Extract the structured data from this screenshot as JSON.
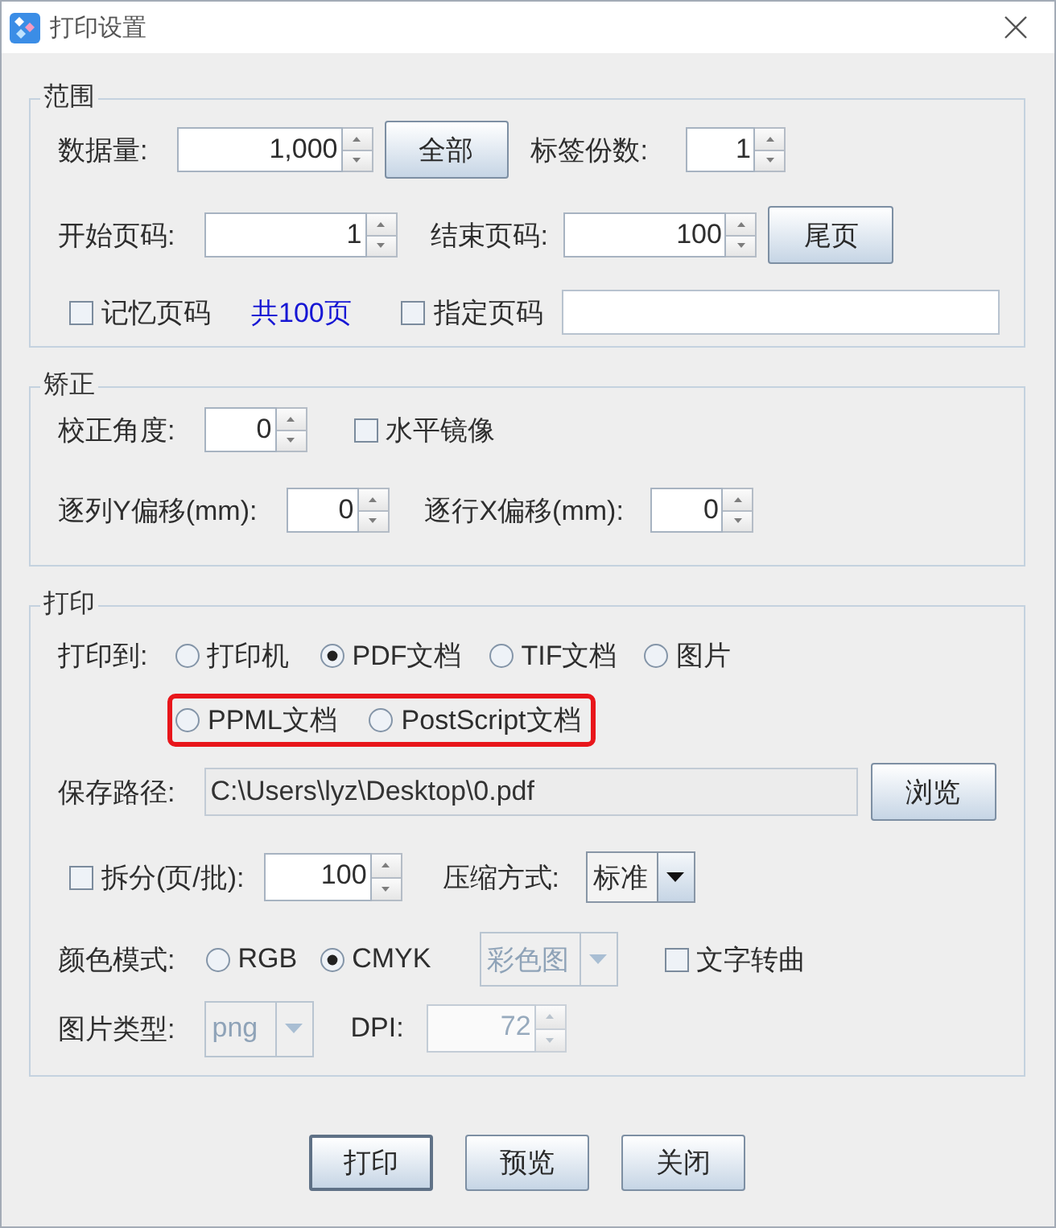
{
  "window": {
    "title": "打印设置"
  },
  "groups": [
    {
      "legend": "范围",
      "rows": [
        [
          {
            "kind": "label",
            "text": "数据量:"
          },
          {
            "kind": "spinner",
            "value": "1,000",
            "disabled": false
          },
          {
            "kind": "button",
            "label": "全部"
          },
          {
            "kind": "label",
            "text": "标签份数:"
          },
          {
            "kind": "spinner",
            "value": "1",
            "disabled": false
          }
        ],
        [
          {
            "kind": "label",
            "text": "开始页码:"
          },
          {
            "kind": "spinner",
            "value": "1",
            "disabled": false
          },
          {
            "kind": "label",
            "text": "结束页码:"
          },
          {
            "kind": "spinner",
            "value": "100",
            "disabled": false
          },
          {
            "kind": "button",
            "label": "尾页"
          }
        ],
        [
          {
            "kind": "checkbox",
            "label": "记忆页码",
            "checked": false
          },
          {
            "kind": "note",
            "text": "共100页"
          },
          {
            "kind": "checkbox",
            "label": "指定页码",
            "checked": false
          },
          {
            "kind": "field",
            "readonly": false
          }
        ]
      ]
    },
    {
      "legend": "矫正",
      "rows": [
        [
          {
            "kind": "label",
            "text": "校正角度:"
          },
          {
            "kind": "spinner",
            "value": "0",
            "disabled": false
          },
          {
            "kind": "checkbox",
            "label": "水平镜像",
            "checked": false
          }
        ],
        [
          {
            "kind": "label",
            "text": "逐列Y偏移(mm):"
          },
          {
            "kind": "spinner",
            "value": "0",
            "disabled": false
          },
          {
            "kind": "label",
            "text": "逐行X偏移(mm):"
          },
          {
            "kind": "spinner",
            "value": "0",
            "disabled": false
          }
        ]
      ]
    },
    {
      "legend": "打印",
      "rows": [
        [
          {
            "kind": "label",
            "text": "打印到:"
          },
          {
            "kind": "radio",
            "label": "打印机",
            "selected": false
          },
          {
            "kind": "radio",
            "label": "PDF文档",
            "selected": true
          },
          {
            "kind": "radio",
            "label": "TIF文档",
            "selected": false
          },
          {
            "kind": "radio",
            "label": "图片",
            "selected": false
          }
        ],
        [
          {
            "kind": "highlight",
            "items": [
              {
                "kind": "radio",
                "label": "PPML文档",
                "selected": false
              },
              {
                "kind": "radio",
                "label": "PostScript文档",
                "selected": false
              }
            ]
          }
        ],
        [
          {
            "kind": "label",
            "text": "保存路径:"
          },
          {
            "kind": "field",
            "value": "C:\\Users\\lyz\\Desktop\\0.pdf",
            "readonly": true
          },
          {
            "kind": "button",
            "label": "浏览"
          }
        ],
        [
          {
            "kind": "checkbox",
            "label": "拆分(页/批):",
            "checked": false
          },
          {
            "kind": "spinner",
            "value": "100",
            "disabled": false
          },
          {
            "kind": "label",
            "text": "压缩方式:"
          },
          {
            "kind": "dropdown",
            "value": "标准",
            "disabled": false
          }
        ],
        [
          {
            "kind": "label",
            "text": "颜色模式:"
          },
          {
            "kind": "radio",
            "label": "RGB",
            "selected": false
          },
          {
            "kind": "radio",
            "label": "CMYK",
            "selected": true
          },
          {
            "kind": "dropdown",
            "value": "彩色图",
            "disabled": true
          },
          {
            "kind": "checkbox",
            "label": "文字转曲",
            "checked": false
          }
        ],
        [
          {
            "kind": "label",
            "text": "图片类型:"
          },
          {
            "kind": "dropdown",
            "value": "png",
            "disabled": true
          },
          {
            "kind": "label",
            "text": "DPI:"
          },
          {
            "kind": "spinner",
            "value": "72",
            "disabled": true
          }
        ]
      ]
    }
  ],
  "buttons": [
    {
      "label": "打印",
      "default": true
    },
    {
      "label": "预览",
      "default": false
    },
    {
      "label": "关闭",
      "default": false
    }
  ]
}
